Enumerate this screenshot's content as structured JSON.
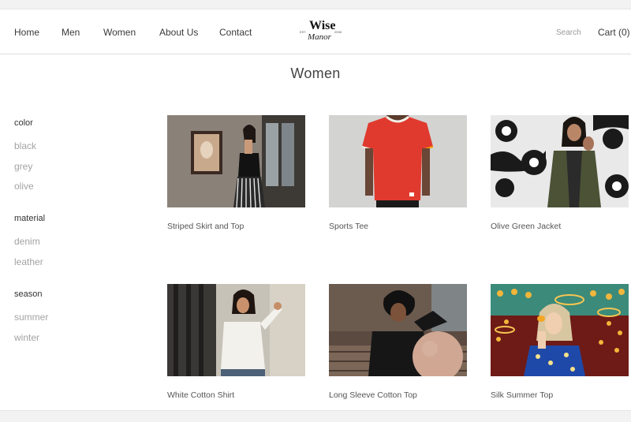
{
  "nav": {
    "items": [
      "Home",
      "Men",
      "Women",
      "About Us",
      "Contact"
    ],
    "search_label": "Search",
    "cart_label": "Cart (0)"
  },
  "logo": {
    "brand_top": "Wise",
    "brand_bottom": "Manor",
    "est": "EST.",
    "year": "2008"
  },
  "page": {
    "title": "Women"
  },
  "filters": [
    {
      "heading": "color",
      "options": [
        "black",
        "grey",
        "olive"
      ]
    },
    {
      "heading": "material",
      "options": [
        "denim",
        "leather"
      ]
    },
    {
      "heading": "season",
      "options": [
        "summer",
        "winter"
      ]
    }
  ],
  "products": [
    {
      "name": "Striped Skirt and Top"
    },
    {
      "name": "Sports Tee"
    },
    {
      "name": "Olive Green Jacket"
    },
    {
      "name": "White Cotton Shirt"
    },
    {
      "name": "Long Sleeve Cotton Top"
    },
    {
      "name": "Silk Summer Top"
    }
  ]
}
